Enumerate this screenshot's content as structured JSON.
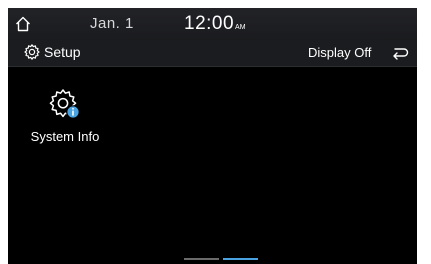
{
  "status_bar": {
    "date": "Jan.  1",
    "time": "12:00",
    "ampm": "AM"
  },
  "header": {
    "title": "Setup",
    "display_off_label": "Display Off"
  },
  "main": {
    "items": [
      {
        "label": "System Info",
        "icon": "gear-info-icon"
      }
    ]
  },
  "page_indicator": {
    "pages": 2,
    "active_page": 2
  },
  "colors": {
    "background": "#000000",
    "bar": "#1b1c1f",
    "accent": "#4aa3e0",
    "inactive_indicator": "#6a6a6a"
  }
}
